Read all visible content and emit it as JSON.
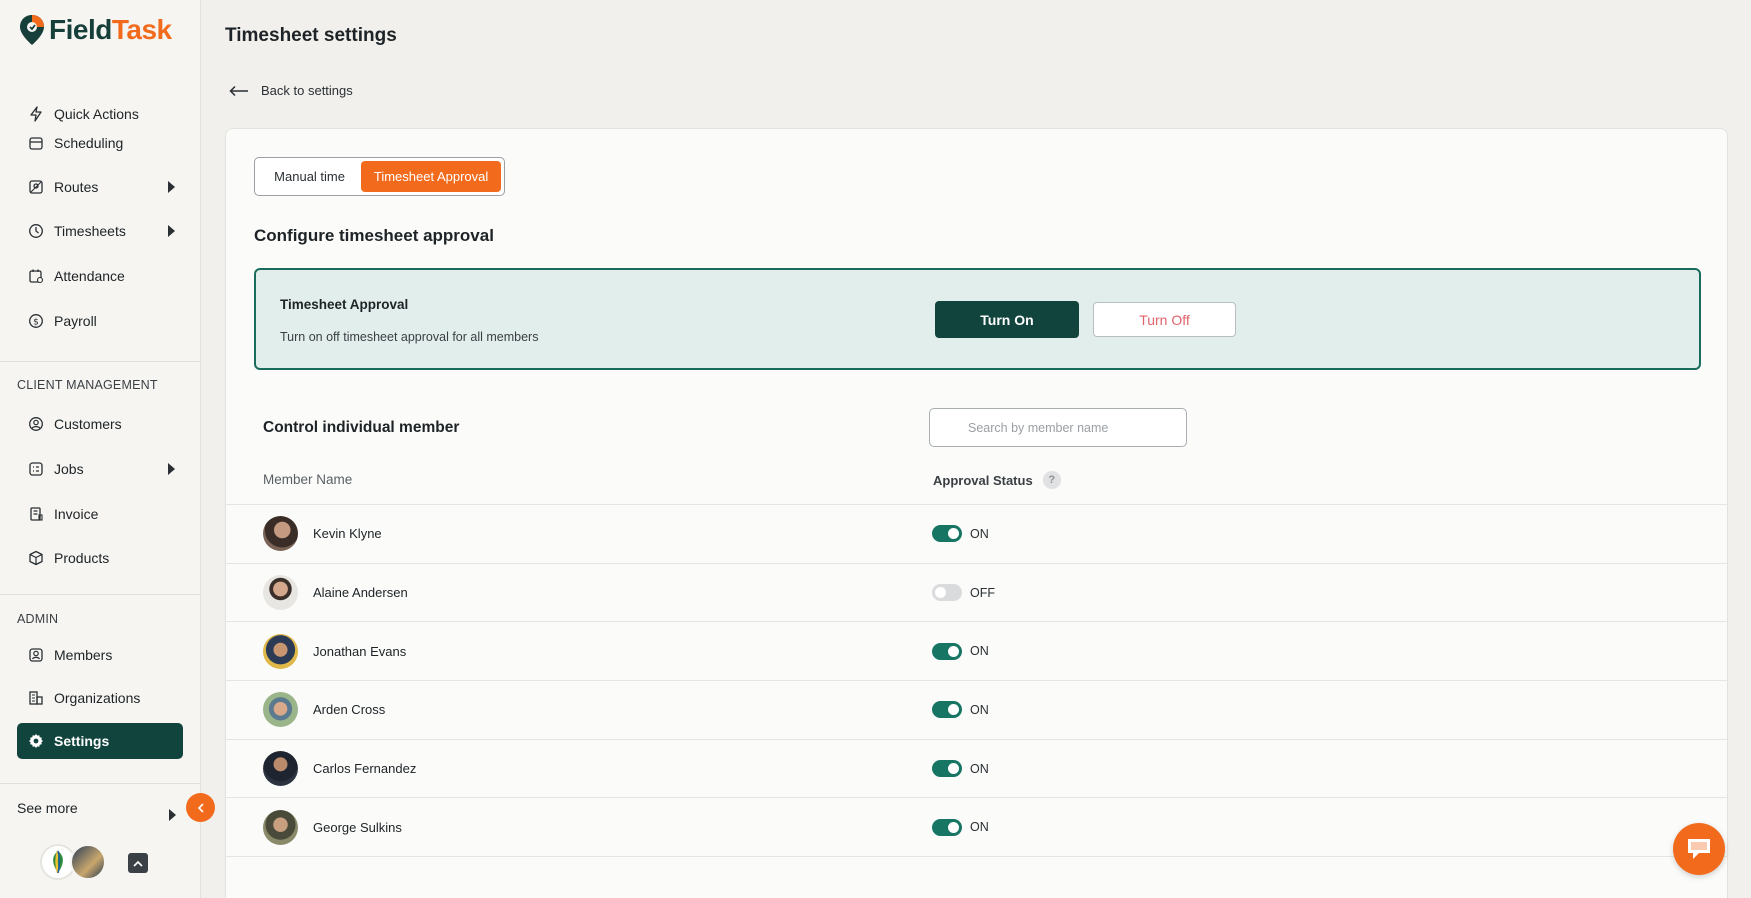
{
  "app": {
    "logo_field": "Field",
    "logo_task": "Task"
  },
  "sidebar": {
    "items": [
      {
        "label": "Quick Actions",
        "icon": "bolt-icon"
      },
      {
        "label": "Scheduling",
        "icon": "calendar-icon"
      },
      {
        "label": "Routes",
        "icon": "map-icon",
        "expandable": true
      },
      {
        "label": "Timesheets",
        "icon": "clock-icon",
        "expandable": true
      },
      {
        "label": "Attendance",
        "icon": "attendance-icon"
      },
      {
        "label": "Payroll",
        "icon": "dollar-icon"
      }
    ],
    "client_section": "CLIENT MANAGEMENT",
    "client_items": [
      {
        "label": "Customers",
        "icon": "user-circle-icon"
      },
      {
        "label": "Jobs",
        "icon": "jobs-icon",
        "expandable": true
      },
      {
        "label": "Invoice",
        "icon": "invoice-icon"
      },
      {
        "label": "Products",
        "icon": "box-icon"
      }
    ],
    "admin_section": "ADMIN",
    "admin_items": [
      {
        "label": "Members",
        "icon": "members-icon"
      },
      {
        "label": "Organizations",
        "icon": "building-icon"
      },
      {
        "label": "Settings",
        "icon": "gear-icon",
        "active": true
      }
    ],
    "see_more": "See more"
  },
  "header": {
    "title": "Timesheet settings",
    "back_label": "Back to settings"
  },
  "tabs": [
    {
      "label": "Manual time",
      "active": false
    },
    {
      "label": "Timesheet Approval",
      "active": true
    }
  ],
  "config": {
    "title": "Configure timesheet approval",
    "box_title": "Timesheet Approval",
    "box_desc": "Turn on off timesheet approval for all members",
    "turn_on": "Turn On",
    "turn_off": "Turn Off"
  },
  "members": {
    "title": "Control individual member",
    "search_placeholder": "Search by member name",
    "col_name": "Member Name",
    "col_status": "Approval Status",
    "help": "?",
    "rows": [
      {
        "name": "Kevin Klyne",
        "status": "ON",
        "on": true
      },
      {
        "name": "Alaine Andersen",
        "status": "OFF",
        "on": false
      },
      {
        "name": "Jonathan Evans",
        "status": "ON",
        "on": true
      },
      {
        "name": "Arden Cross",
        "status": "ON",
        "on": true
      },
      {
        "name": "Carlos Fernandez",
        "status": "ON",
        "on": true
      },
      {
        "name": "George Sulkins",
        "status": "ON",
        "on": true
      }
    ]
  },
  "colors": {
    "brand_dark": "#12443e",
    "brand_orange": "#f26b1d",
    "toggle_on": "#177564"
  }
}
